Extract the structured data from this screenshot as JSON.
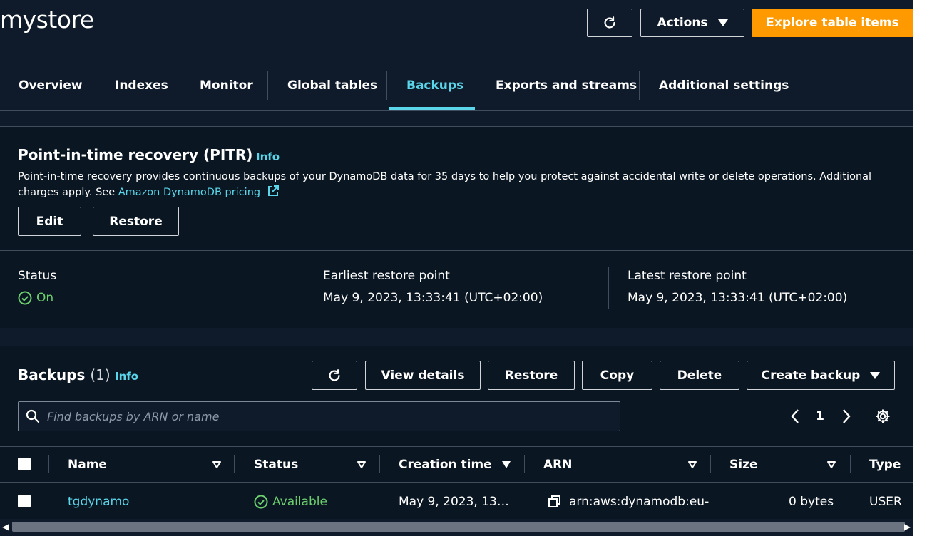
{
  "header": {
    "title": "mystore",
    "refresh_icon": "refresh-icon",
    "actions_label": "Actions",
    "explore_label": "Explore table items"
  },
  "tabs": [
    {
      "label": "Overview"
    },
    {
      "label": "Indexes"
    },
    {
      "label": "Monitor"
    },
    {
      "label": "Global tables"
    },
    {
      "label": "Backups",
      "active": true
    },
    {
      "label": "Exports and streams"
    },
    {
      "label": "Additional settings"
    }
  ],
  "pitr": {
    "title": "Point-in-time recovery (PITR)",
    "info": "Info",
    "description": "Point-in-time recovery provides continuous backups of your DynamoDB data for 35 days to help you protect against accidental write or delete operations. Additional charges apply. See",
    "link_text": "Amazon DynamoDB pricing",
    "edit_label": "Edit",
    "restore_label": "Restore",
    "status_label": "Status",
    "status_value": "On",
    "earliest_label": "Earliest restore point",
    "earliest_value": "May 9, 2023, 13:33:41 (UTC+02:00)",
    "latest_label": "Latest restore point",
    "latest_value": "May 9, 2023, 13:33:41 (UTC+02:00)"
  },
  "backups": {
    "title": "Backups",
    "count": "(1)",
    "info": "Info",
    "view_details_label": "View details",
    "restore_label": "Restore",
    "copy_label": "Copy",
    "delete_label": "Delete",
    "create_label": "Create backup",
    "search_placeholder": "Find backups by ARN or name",
    "page": "1",
    "columns": [
      "Name",
      "Status",
      "Creation time",
      "ARN",
      "Size",
      "Type"
    ],
    "rows": [
      {
        "name": "tgdynamo",
        "status": "Available",
        "creation_time": "May 9, 2023, 13…",
        "arn": "arn:aws:dynamodb:eu-c",
        "size": "0 bytes",
        "type": "USER"
      }
    ]
  },
  "colors": {
    "accent": "#5ad5e9",
    "primary_button": "#ff9900",
    "success": "#6ccf6d",
    "background": "#0f1b2a"
  }
}
